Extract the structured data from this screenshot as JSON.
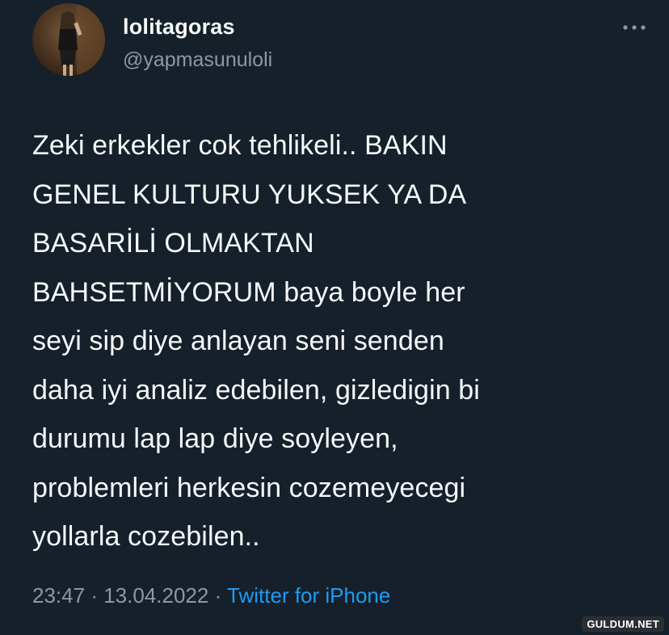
{
  "author": {
    "display_name": "lolitagoras",
    "username": "@yapmasunuloli",
    "avatar_icon": "profile-photo"
  },
  "more_icon": "more-horizontal-icon",
  "tweet": {
    "text": "Zeki erkekler cok tehlikeli.. BAKIN\nGENEL KULTURU YUKSEK YA DA\nBASARİLİ OLMAKTAN\nBAHSETMİYORUM baya boyle her\nseyi sip diye anlayan seni senden\ndaha iyi analiz edebilen, gizledigin bi\ndurumu lap lap diye soyleyen,\nproblemleri herkesin cozemeyecegi\nyollarla cozebilen.."
  },
  "meta": {
    "time": "23:47",
    "separator": "·",
    "date": "13.04.2022",
    "source": "Twitter for iPhone"
  },
  "watermark": "GULDUM.NET",
  "colors": {
    "background": "#15202b",
    "text_primary": "#f7f9f9",
    "text_secondary": "#8b98a5",
    "link": "#1d9bf0"
  }
}
